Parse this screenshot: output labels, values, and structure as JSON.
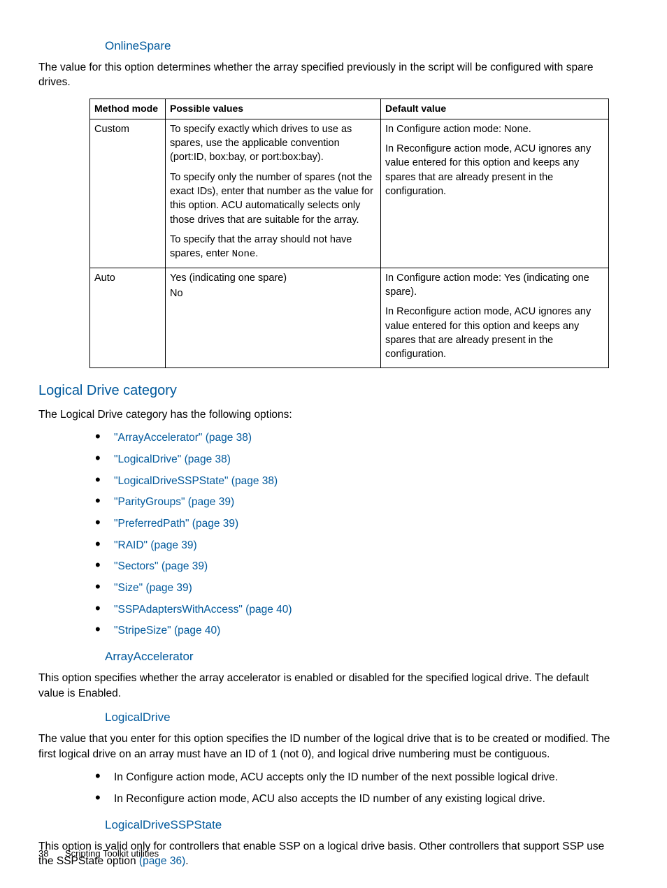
{
  "section_onlinespare": {
    "heading": "OnlineSpare",
    "intro": "The value for this option determines whether the array specified previously in the script will be configured with spare drives."
  },
  "table": {
    "headers": {
      "c1": "Method mode",
      "c2": "Possible values",
      "c3": "Default value"
    },
    "rows": [
      {
        "mode": "Custom",
        "possible_p1": "To specify exactly which drives to use as spares, use the applicable convention (port:ID, box:bay, or port:box:bay).",
        "possible_p2": "To specify only the number of spares (not the exact IDs), enter that number as the value for this option. ACU automatically selects only those drives that are suitable for the array.",
        "possible_p3_pre": "To specify that the array should not have spares, enter ",
        "possible_p3_mono": "None",
        "possible_p3_post": ".",
        "default_p1": "In Configure action mode: None.",
        "default_p2": "In Reconfigure action mode, ACU ignores any value entered for this option and keeps any spares that are already present in the configuration."
      },
      {
        "mode": "Auto",
        "possible_p1": "Yes (indicating one spare)",
        "possible_p2": "No",
        "default_p1": "In Configure action mode: Yes (indicating one spare).",
        "default_p2": "In Reconfigure action mode, ACU ignores any value entered for this option and keeps any spares that are already present in the configuration."
      }
    ]
  },
  "section_ldc": {
    "heading": "Logical Drive category",
    "intro": "The Logical Drive category has the following options:",
    "items": [
      "\"ArrayAccelerator\" (page 38)",
      "\"LogicalDrive\" (page 38)",
      "\"LogicalDriveSSPState\" (page 38)",
      "\"ParityGroups\" (page 39)",
      "\"PreferredPath\" (page 39)",
      "\"RAID\" (page 39)",
      "\"Sectors\" (page 39)",
      "\"Size\" (page 39)",
      "\"SSPAdaptersWithAccess\" (page 40)",
      "\"StripeSize\" (page 40)"
    ]
  },
  "section_aa": {
    "heading": "ArrayAccelerator",
    "para": "This option specifies whether the array accelerator is enabled or disabled for the specified logical drive. The default value is Enabled."
  },
  "section_ld": {
    "heading": "LogicalDrive",
    "para": "The value that you enter for this option specifies the ID number of the logical drive that is to be created or modified. The first logical drive on an array must have an ID of 1 (not 0), and logical drive numbering must be contiguous.",
    "bullets": [
      "In Configure action mode, ACU accepts only the ID number of the next possible logical drive.",
      "In Reconfigure action mode, ACU also accepts the ID number of any existing logical drive."
    ]
  },
  "section_ssp": {
    "heading": "LogicalDriveSSPState",
    "para_pre": "This option is valid only for controllers that enable SSP on a logical drive basis. Other controllers that support SSP use the SSPState option ",
    "para_link": "(page 36)",
    "para_post": "."
  },
  "footer": {
    "page": "38",
    "title": "Scripting Toolkit utilities"
  }
}
